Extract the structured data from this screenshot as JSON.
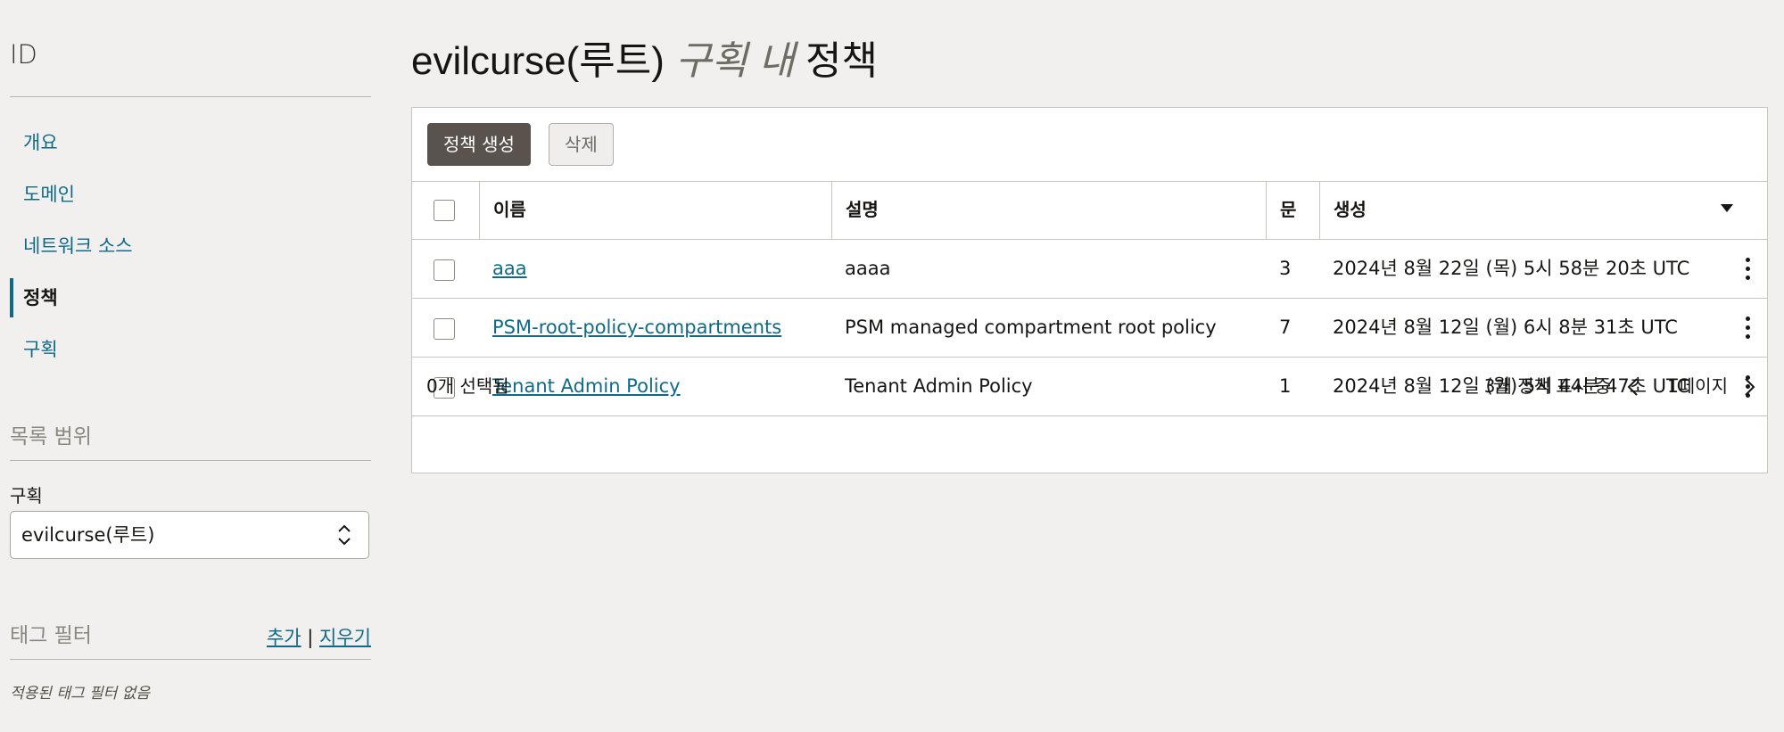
{
  "sidebar": {
    "title": "ID",
    "nav": [
      {
        "label": "개요",
        "active": false
      },
      {
        "label": "도메인",
        "active": false
      },
      {
        "label": "네트워크 소스",
        "active": false
      },
      {
        "label": "정책",
        "active": true
      },
      {
        "label": "구획",
        "active": false
      }
    ],
    "scope": {
      "heading": "목록 범위",
      "compartment_label": "구획",
      "compartment_value": "evilcurse(루트)"
    },
    "tag_filter": {
      "heading": "태그 필터",
      "add_label": "추가",
      "separator": "|",
      "clear_label": "지우기",
      "empty_text": "적용된 태그 필터 없음"
    }
  },
  "main": {
    "title_prefix": "evilcurse(루트)",
    "title_italic": "구획 내",
    "title_suffix": "정책",
    "toolbar": {
      "create_label": "정책 생성",
      "delete_label": "삭제"
    },
    "columns": {
      "name": "이름",
      "description": "설명",
      "statements": "문",
      "created": "생성"
    },
    "rows": [
      {
        "name": "aaa",
        "description": "aaaa",
        "statements": "3",
        "created": "2024년 8월 22일 (목) 5시 58분 20초 UTC"
      },
      {
        "name": "PSM-root-policy-compartments",
        "description": "PSM managed compartment root policy",
        "statements": "7",
        "created": "2024년 8월 12일 (월) 6시 8분 31초 UTC"
      },
      {
        "name": "Tenant Admin Policy",
        "description": "Tenant Admin Policy",
        "statements": "1",
        "created": "2024년 8월 12일 (월) 5시 44분 47초 UTC"
      }
    ],
    "footer": {
      "selected": "0개 선택됨",
      "count": "3개 정책 표시 중",
      "page": "1페이지"
    }
  },
  "icons": {
    "select": "chevron-up-down-icon",
    "sort": "caret-down-icon",
    "row_menu": "kebab-icon",
    "prev": "chevron-left-icon",
    "next": "chevron-right-icon"
  },
  "colors": {
    "link": "#0f6a8a",
    "primary_button": "#5a524c",
    "background": "#f1f0ee"
  }
}
